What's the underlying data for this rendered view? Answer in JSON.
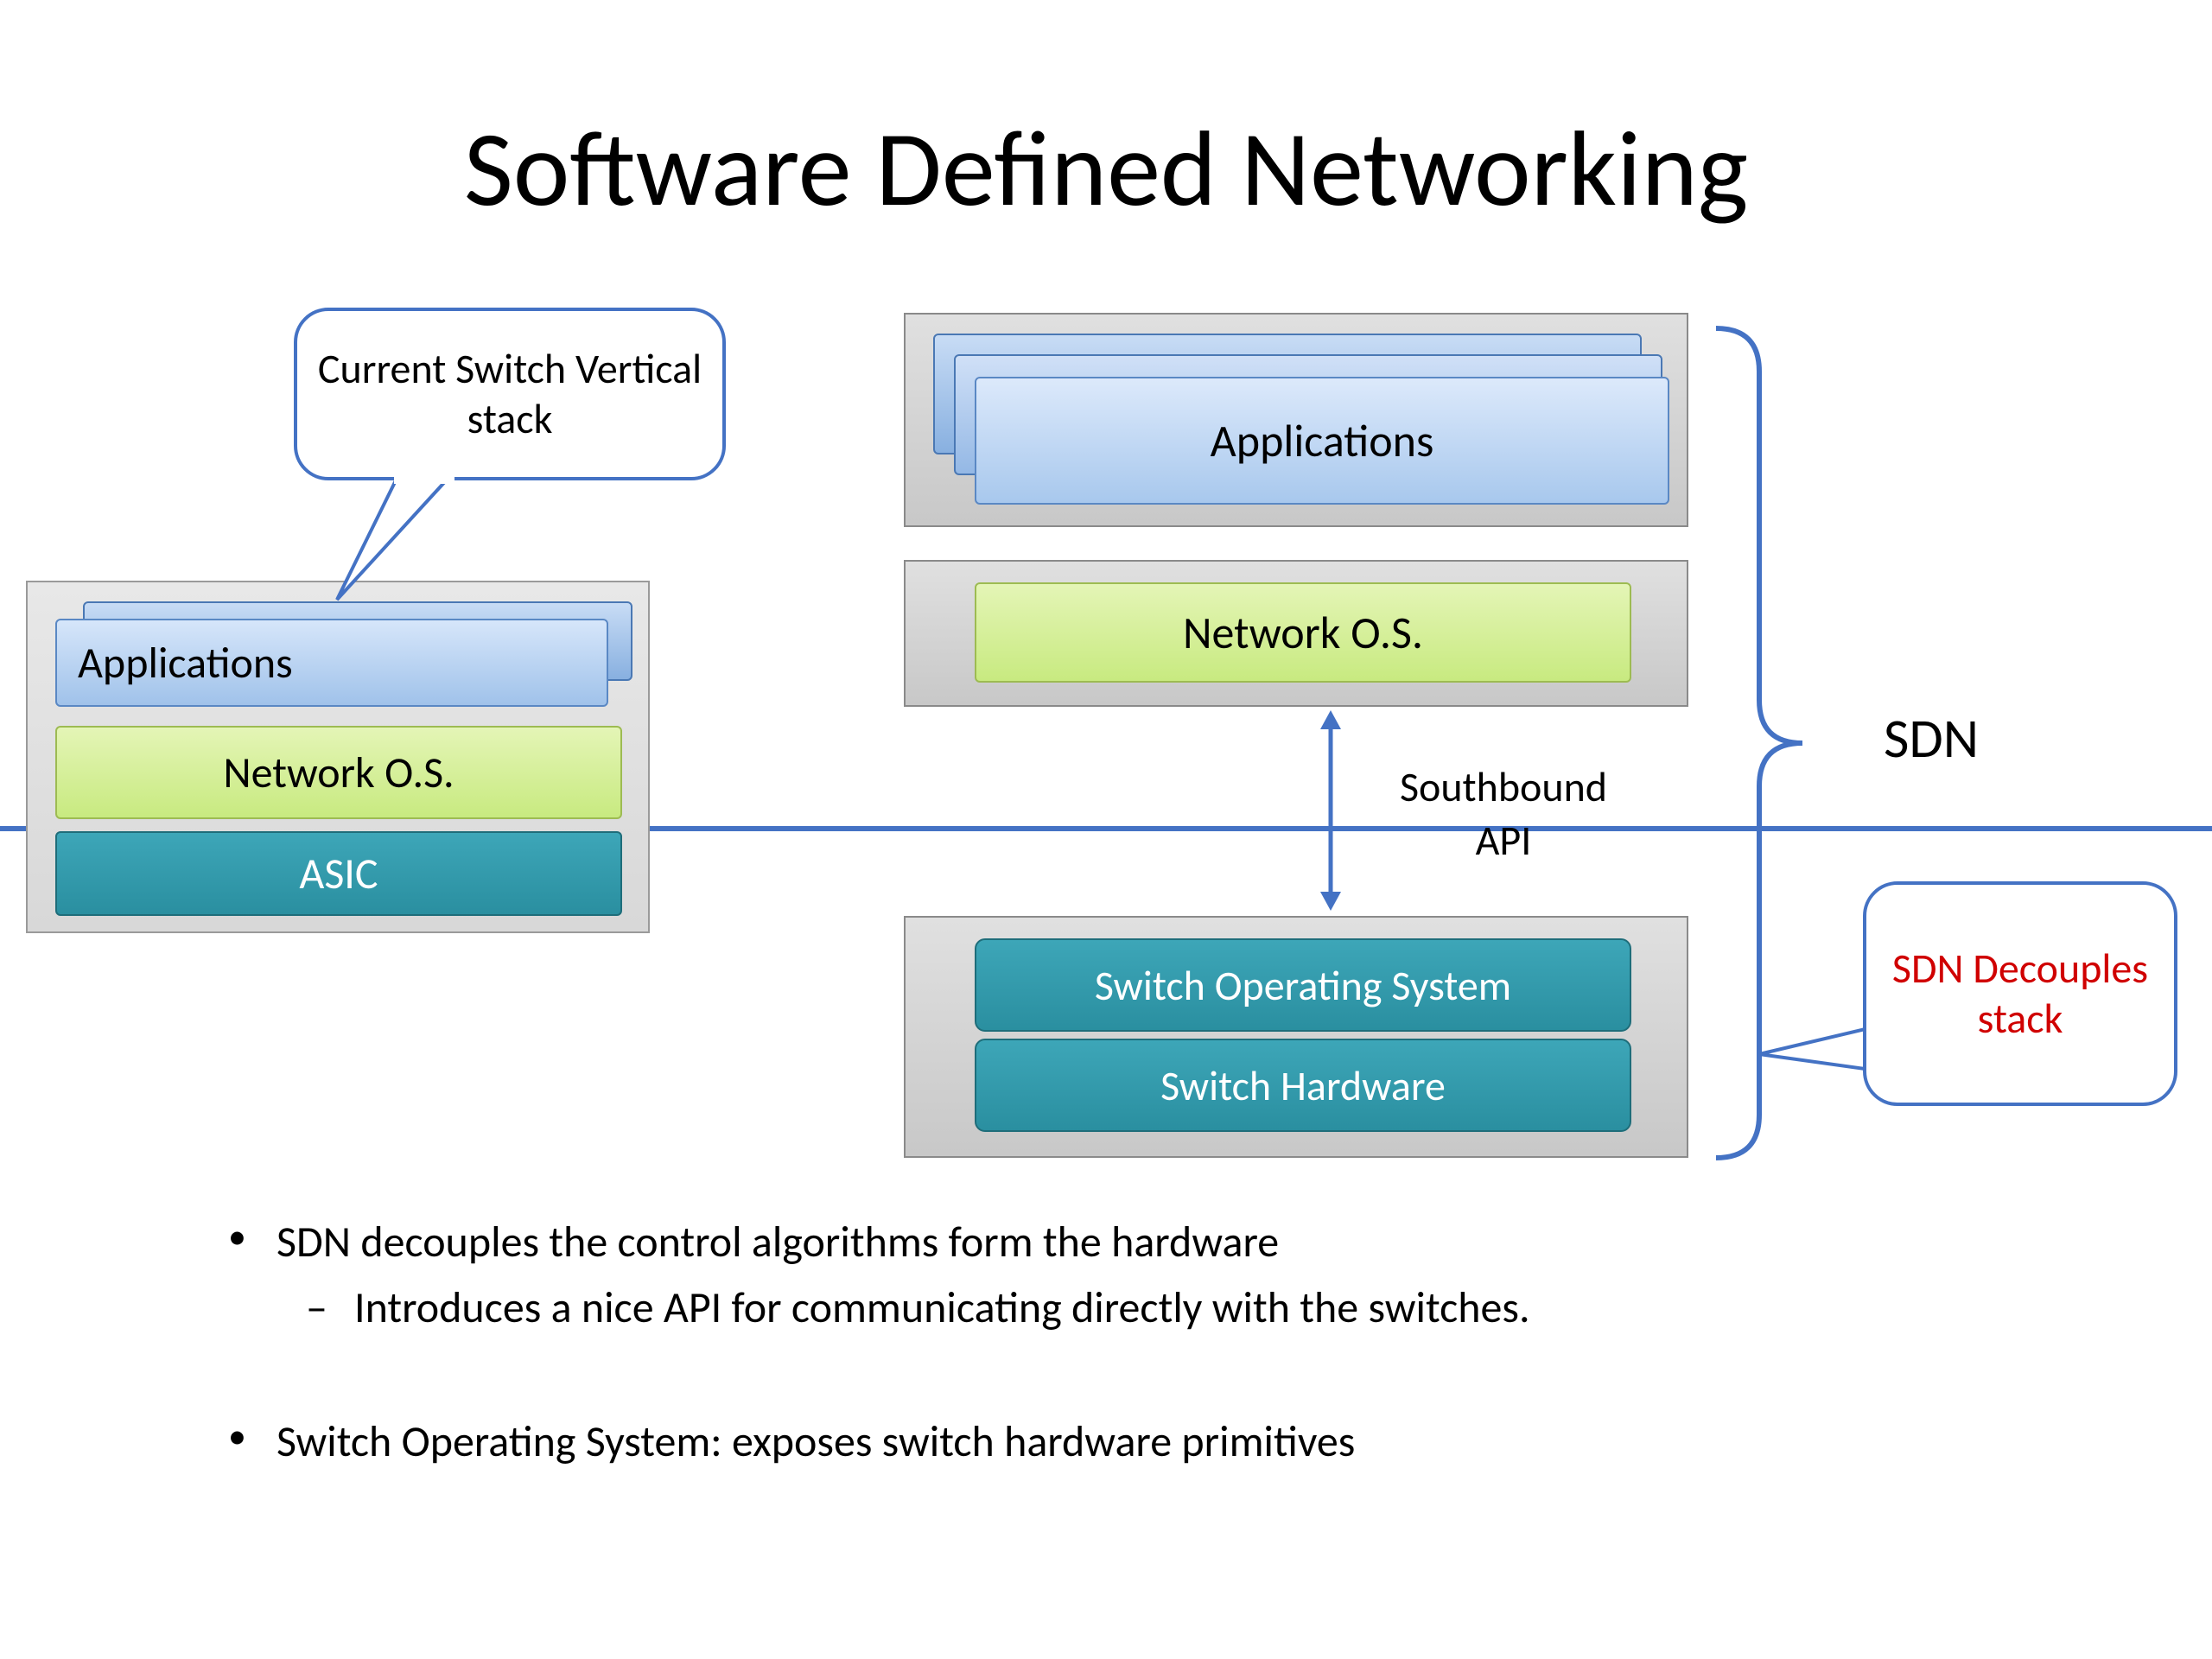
{
  "title": "Software Defined Networking",
  "callout_top": "Current Switch Vertical stack",
  "left_stack": {
    "applications": "Applications",
    "network_os": "Network O.S.",
    "asic": "ASIC"
  },
  "right_stack": {
    "applications": "Applications",
    "network_os": "Network O.S.",
    "switch_os": "Switch Operating System",
    "switch_hw": "Switch Hardware"
  },
  "southbound_label": "Southbound API",
  "sdn_label": "SDN",
  "callout_right": "SDN Decouples stack",
  "bullets": {
    "b1": "SDN decouples the control algorithms form the hardware",
    "b1a": "Introduces a nice API for communicating directly with the switches.",
    "b2": "Switch Operating System: exposes switch hardware primitives"
  }
}
